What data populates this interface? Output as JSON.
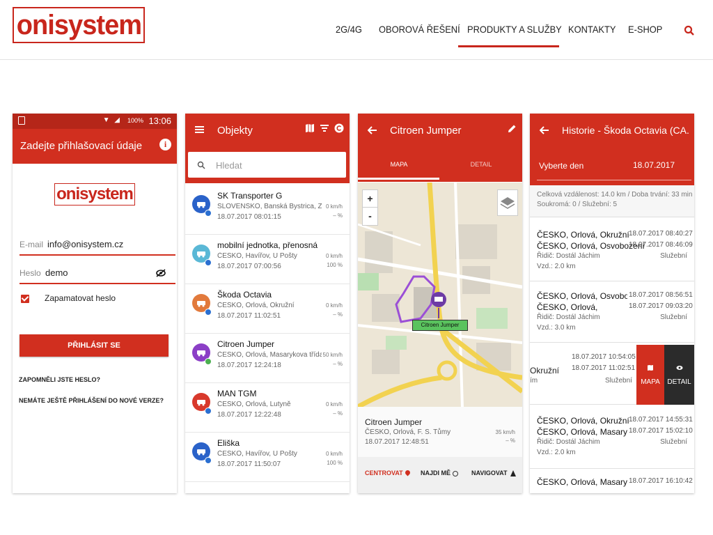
{
  "site": {
    "logo": "onisystem",
    "nav": [
      {
        "label": "2G/4G"
      },
      {
        "label": "OBOROVÁ ŘEŠENÍ"
      },
      {
        "label": "PRODUKTY A SLUŽBY",
        "active": true
      },
      {
        "label": "KONTAKTY"
      },
      {
        "label": "E-SHOP"
      }
    ],
    "accent": "#c8261c"
  },
  "login": {
    "status_time": "13:06",
    "status_battery": "100%",
    "title": "Zadejte přihlašovací údaje",
    "logo": "onisystem",
    "email_label": "E-mail",
    "email_value": "info@onisystem.cz",
    "password_label": "Heslo",
    "password_value": "demo",
    "remember_label": "Zapamatovat heslo",
    "remember_checked": true,
    "login_button": "PŘIHLÁSIT SE",
    "forgot_link": "ZAPOMNĚLI JSTE HESLO?",
    "no_login_link": "NEMÁTE JEŠTĚ PŘIHLÁŠENÍ DO NOVÉ VERZE?"
  },
  "objects": {
    "title": "Objekty",
    "search_placeholder": "Hledat",
    "items": [
      {
        "name": "SK Transporter G",
        "location": "SLOVENSKO, Banská Bystrica, Zvo...",
        "time": "18.07.2017 08:01:15",
        "speed": "0 km/h",
        "pct": "– %",
        "color": "#2a62c9",
        "icon": "truck-icon"
      },
      {
        "name": "mobilní jednotka, přenosná",
        "location": "ČESKO, Havířov, U Pošty",
        "time": "18.07.2017 07:00:56",
        "speed": "0 km/h",
        "pct": "100 %",
        "color": "#5ab8d6",
        "icon": "motorbike-icon"
      },
      {
        "name": "Škoda Octavia",
        "location": "ČESKO, Orlová, Okružní",
        "time": "18.07.2017 11:02:51",
        "speed": "0 km/h",
        "pct": "– %",
        "color": "#e27a3c",
        "icon": "car-icon"
      },
      {
        "name": "Citroen Jumper",
        "location": "ČESKO, Orlová, Masarykova třída",
        "time": "18.07.2017 12:24:18",
        "speed": "50 km/h",
        "pct": "– %",
        "color": "#8b3fc6",
        "icon": "van-icon"
      },
      {
        "name": "MAN TGM",
        "location": "ČESKO, Orlová, Lutyně",
        "time": "18.07.2017 12:22:48",
        "speed": "0 km/h",
        "pct": "– %",
        "color": "#d8392c",
        "icon": "tow-truck-icon"
      },
      {
        "name": "Eliška",
        "location": "ČESKO, Havířov, U Pošty",
        "time": "18.07.2017 11:50:07",
        "speed": "0 km/h",
        "pct": "100 %",
        "color": "#2a62c9",
        "icon": "person-icon"
      }
    ]
  },
  "vehicle": {
    "title": "Citroen Jumper",
    "tab_map": "MAPA",
    "tab_detail": "DETAIL",
    "map_label": "Citroen Jumper",
    "name": "Citroen Jumper",
    "location": "ČESKO, Orlová, F. S. Tůmy",
    "time": "18.07.2017 12:48:51",
    "speed": "35 km/h",
    "pct": "– %",
    "action_center": "CENTROVAT",
    "action_find": "NAJDI MĚ",
    "action_navigate": "NAVIGOVAT"
  },
  "history": {
    "title": "Historie - Škoda Octavia (CA...",
    "day_label": "Vyberte den",
    "day_value": "18.07.2017",
    "summary_line1": "Celková vzdálenost: 14.0 km / Doba trvání: 33 min 4...",
    "summary_line2": "Soukromá: 0 / Služební: 5",
    "rows": [
      {
        "from": "ČESKO, Orlová, Okružní",
        "to": "ČESKO, Orlová, Osvobození",
        "start": "18.07.2017 08:40:27",
        "end": "18.07.2017 08:46:09",
        "driver": "Řidič: Dostál Jáchim",
        "distance": "Vzd.: 2.0 km",
        "type": "Služební"
      },
      {
        "from": "ČESKO, Orlová, Osvoboze...",
        "to": "ČESKO, Orlová,",
        "start": "18.07.2017 08:56:51",
        "end": "18.07.2017 09:03:20",
        "driver": "Řidič: Dostál Jáchim",
        "distance": "Vzd.: 3.0 km",
        "type": "Služební"
      },
      {
        "from": "ČESKO, Orlová, Okružní",
        "to": "ČESKO, Orlová, Masaryko...",
        "start": "18.07.2017 14:55:31",
        "end": "18.07.2017 15:02:10",
        "driver": "Řidič: Dostál Jáchim",
        "distance": "Vzd.: 2.0 km",
        "type": "Služební"
      },
      {
        "from": "ČESKO, Orlová, Masaryko...",
        "to": "",
        "start": "18.07.2017 16:10:42",
        "end": "",
        "driver": "",
        "distance": "",
        "type": ""
      }
    ],
    "swipe_row": {
      "from": "Okružní",
      "sub": "ím",
      "start": "18.07.2017 10:54:05",
      "end": "18.07.2017 11:02:51",
      "type": "Služební",
      "map_btn": "MAPA",
      "detail_btn": "DETAIL"
    }
  }
}
